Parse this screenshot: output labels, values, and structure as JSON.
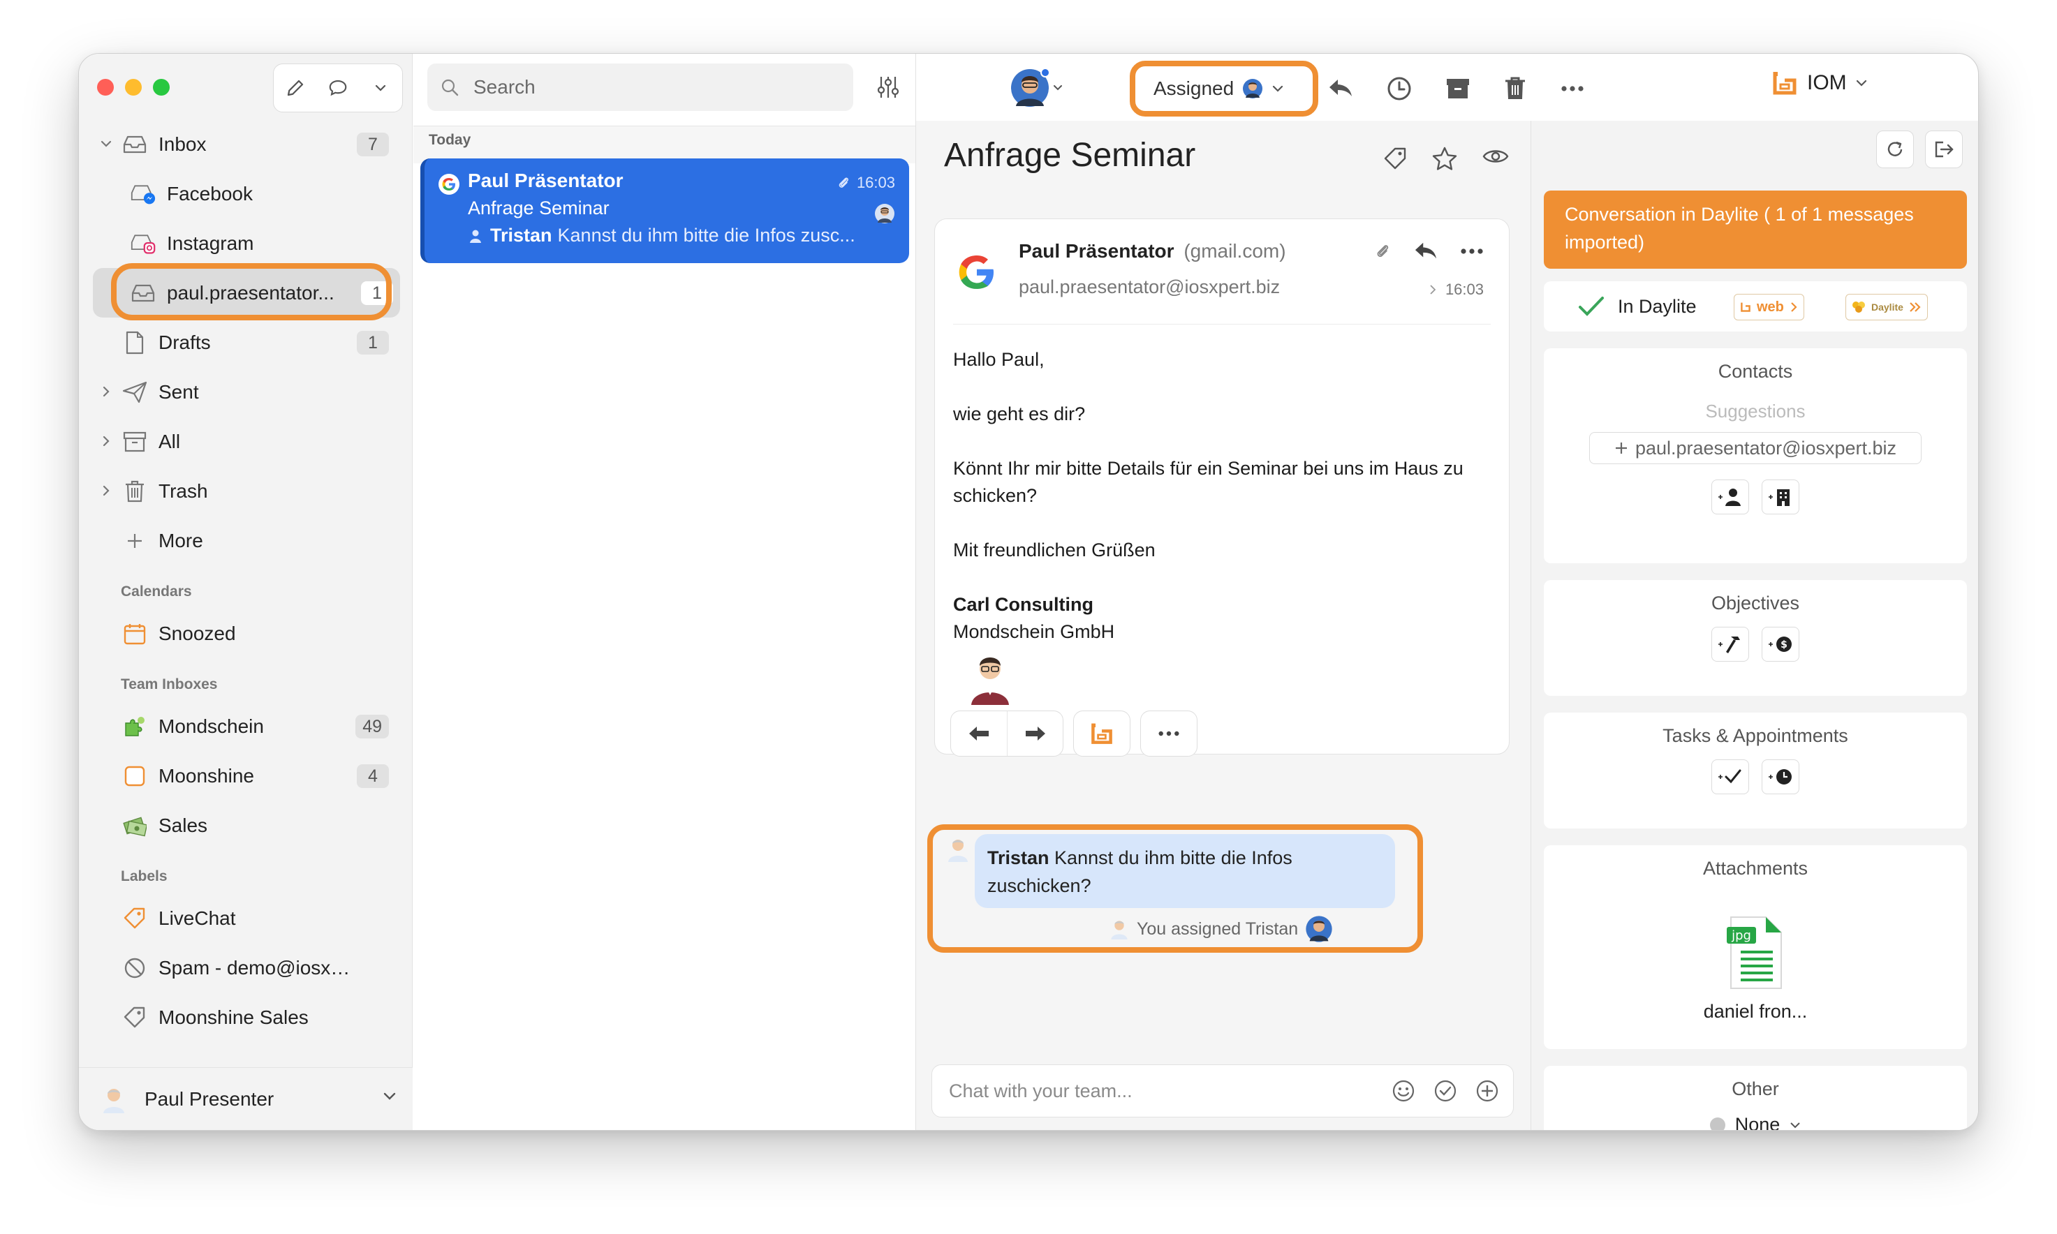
{
  "window": {
    "traffic_lights": [
      "close",
      "minimize",
      "zoom"
    ]
  },
  "sidebar": {
    "items": [
      {
        "label": "Inbox",
        "count": "7",
        "icon": "inbox-icon"
      },
      {
        "label": "Facebook",
        "icon": "facebook-inbox-icon"
      },
      {
        "label": "Instagram",
        "icon": "instagram-inbox-icon"
      },
      {
        "label": "paul.praesentator...",
        "count": "1",
        "icon": "inbox-icon",
        "selected": true
      },
      {
        "label": "Drafts",
        "count": "1",
        "icon": "draft-icon"
      },
      {
        "label": "Sent",
        "icon": "paper-plane-icon"
      },
      {
        "label": "All",
        "icon": "archive-icon"
      },
      {
        "label": "Trash",
        "icon": "trash-icon"
      },
      {
        "label": "More",
        "icon": "plus-icon"
      }
    ],
    "calendars_title": "Calendars",
    "calendars": [
      {
        "label": "Snoozed",
        "icon": "calendar-icon"
      }
    ],
    "team_inboxes_title": "Team Inboxes",
    "team_inboxes": [
      {
        "label": "Mondschein",
        "count": "49",
        "icon": "puzzle-icon"
      },
      {
        "label": "Moonshine",
        "count": "4",
        "icon": "orange-square-icon"
      },
      {
        "label": "Sales",
        "icon": "money-icon"
      }
    ],
    "labels_title": "Labels",
    "labels": [
      {
        "label": "LiveChat",
        "icon": "tag-orange-icon"
      },
      {
        "label": "Spam - demo@iosxpert...",
        "icon": "prohibited-icon"
      },
      {
        "label": "Moonshine Sales",
        "icon": "tag-icon"
      }
    ],
    "user": "Paul Presenter"
  },
  "list": {
    "search_placeholder": "Search",
    "section": "Today",
    "message": {
      "from": "Paul Präsentator",
      "time": "16:03",
      "subject": "Anfrage Seminar",
      "snippet_author": "Tristan",
      "snippet": "Kannst du ihm bitte die Infos zusc..."
    }
  },
  "toolbar": {
    "assigned_label": "Assigned",
    "account_label": "IOM"
  },
  "reading": {
    "subject": "Anfrage Seminar",
    "sender_name": "Paul Präsentator",
    "sender_domain": "(gmail.com)",
    "sender_address": "paul.praesentator@iosxpert.biz",
    "time": "16:03",
    "body": [
      "Hallo Paul,",
      "wie geht es dir?",
      "Könnt Ihr mir bitte Details für ein Seminar bei uns im Haus zu schicken?",
      "Mit freundlichen Grüßen"
    ],
    "signature_company": "Carl Consulting",
    "signature_line2": "Mondschein GmbH",
    "chat": {
      "author": "Tristan",
      "text": "Kannst du ihm bitte die Infos zuschicken?",
      "assign_note": "You assigned Tristan"
    },
    "chat_placeholder": "Chat with your team..."
  },
  "rpanel": {
    "banner": "Conversation in Daylite ( 1 of 1 messages imported)",
    "in_daylite": "In Daylite",
    "badge_web": "web",
    "badge_daylite": "Daylite",
    "contacts_title": "Contacts",
    "suggestions_title": "Suggestions",
    "suggestion_email": "paul.praesentator@iosxpert.biz",
    "objectives_title": "Objectives",
    "tasks_title": "Tasks & Appointments",
    "attachments_title": "Attachments",
    "attachment_ext": "jpg",
    "attachment_name": "daniel fron...",
    "other_title": "Other",
    "other_value": "None"
  },
  "colors": {
    "accent_orange": "#ef8f33",
    "selection_blue": "#2c6fe3",
    "chat_bubble": "#d7e6fb"
  }
}
